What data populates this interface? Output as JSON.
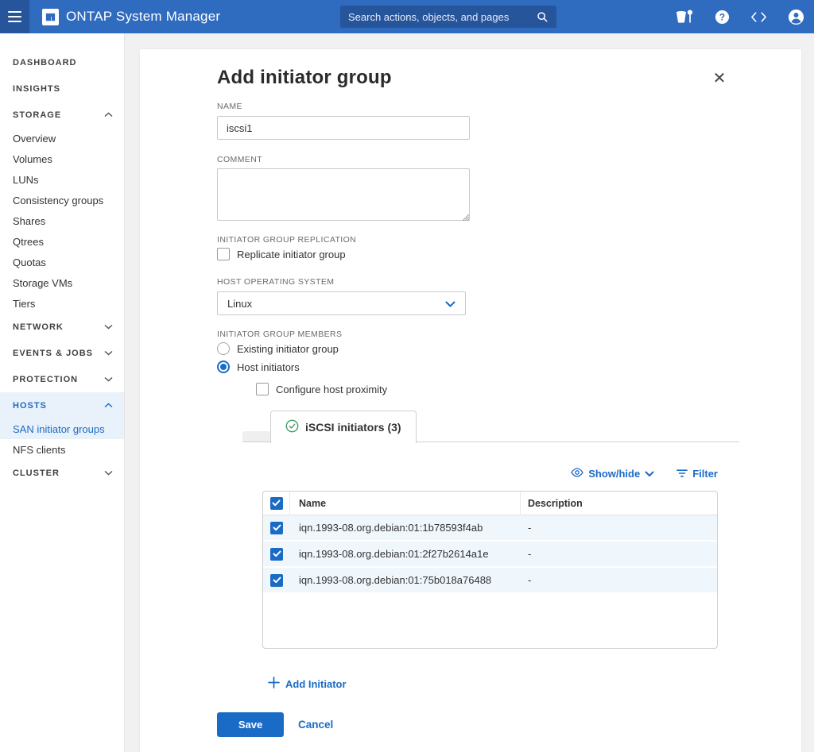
{
  "header": {
    "app_title": "ONTAP System Manager",
    "search_placeholder": "Search actions, objects, and pages"
  },
  "sidebar": {
    "dashboard": "DASHBOARD",
    "insights": "INSIGHTS",
    "storage": "STORAGE",
    "storage_children": [
      "Overview",
      "Volumes",
      "LUNs",
      "Consistency groups",
      "Shares",
      "Qtrees",
      "Quotas",
      "Storage VMs",
      "Tiers"
    ],
    "network": "NETWORK",
    "events": "EVENTS & JOBS",
    "protection": "PROTECTION",
    "hosts": "HOSTS",
    "hosts_children": [
      "SAN initiator groups",
      "NFS clients"
    ],
    "cluster": "CLUSTER"
  },
  "dialog": {
    "title": "Add initiator group",
    "name_label": "NAME",
    "name_value": "iscsi1",
    "comment_label": "COMMENT",
    "comment_value": "",
    "replication_label": "INITIATOR GROUP REPLICATION",
    "replicate_checkbox_label": "Replicate initiator group",
    "host_os_label": "HOST OPERATING SYSTEM",
    "host_os_value": "Linux",
    "members_label": "INITIATOR GROUP MEMBERS",
    "members_options": [
      "Existing initiator group",
      "Host initiators"
    ],
    "proximity_checkbox_label": "Configure host proximity",
    "tab_label": "iSCSI initiators (3)",
    "showhide_label": "Show/hide",
    "filter_label": "Filter",
    "table": {
      "columns": [
        "Name",
        "Description"
      ],
      "rows": [
        {
          "name": "iqn.1993-08.org.debian:01:1b78593f4ab",
          "description": "-"
        },
        {
          "name": "iqn.1993-08.org.debian:01:2f27b2614a1e",
          "description": "-"
        },
        {
          "name": "iqn.1993-08.org.debian:01:75b018a76488",
          "description": "-"
        }
      ]
    },
    "add_initiator_label": "Add Initiator",
    "save_label": "Save",
    "cancel_label": "Cancel"
  },
  "colors": {
    "header_bg": "#2f6bbf",
    "header_dark": "#27559c",
    "accent": "#1a6bc6",
    "selected_row_bg": "#eff6fc",
    "sidebar_active_bg": "#e9f2fb",
    "tab_check_green": "#44a06b"
  }
}
